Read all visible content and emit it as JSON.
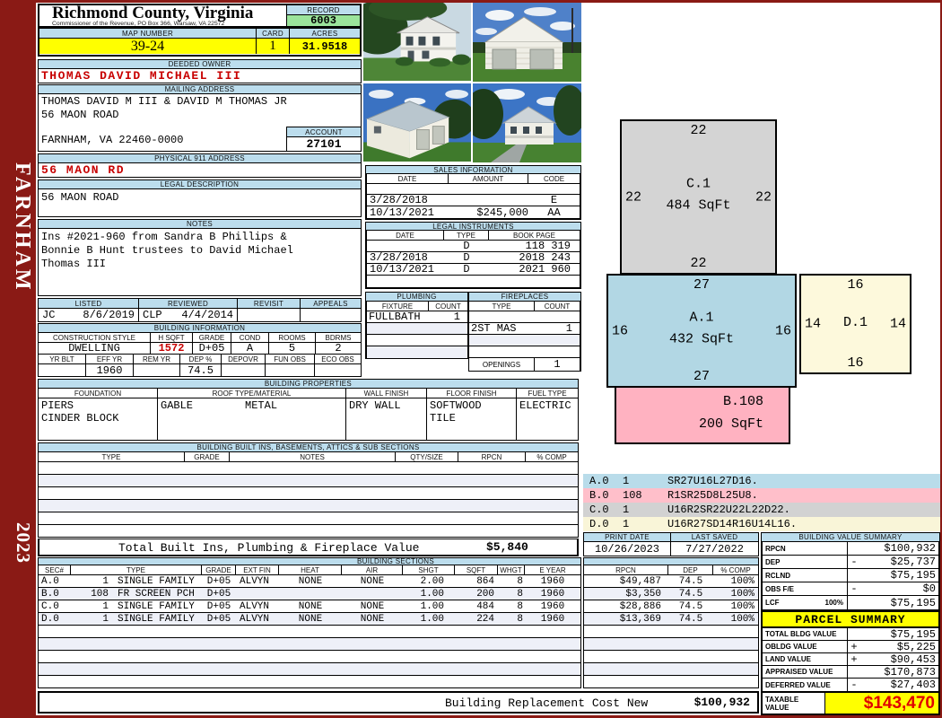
{
  "header": {
    "county": "Richmond County, Virginia",
    "commissioner": "Commissioner of the Revenue, PO Box 366, Warsaw, VA 22572",
    "record_label": "RECORD",
    "record_value": "6003",
    "map_label": "MAP NUMBER",
    "map_value": "39-24",
    "card_label": "CARD",
    "card_value": "1",
    "acres_label": "ACRES",
    "acres_value": "31.9518"
  },
  "sidebar": {
    "district": "FARNHAM",
    "year": "2023"
  },
  "owner": {
    "label": "DEEDED OWNER",
    "name": "THOMAS DAVID MICHAEL III"
  },
  "mailing": {
    "label": "MAILING ADDRESS",
    "line1": "THOMAS DAVID M III & DAVID M THOMAS JR",
    "line2": "56 MAON ROAD",
    "line3": "FARNHAM, VA 22460-0000",
    "account_label": "ACCOUNT",
    "account_value": "27101"
  },
  "physical": {
    "label": "PHYSICAL 911 ADDRESS",
    "value": "56 MAON RD"
  },
  "legal_description": {
    "label": "LEGAL DESCRIPTION",
    "value": "56 MAON ROAD"
  },
  "notes": {
    "label": "NOTES",
    "line1": "Ins #2021-960 from Sandra B Phillips &",
    "line2": "Bonnie B Hunt trustees to David Michael",
    "line3": "Thomas III"
  },
  "review": {
    "listed_label": "LISTED",
    "listed_by": "JC",
    "listed_date": "8/6/2019",
    "reviewed_label": "REVIEWED",
    "reviewed_by": "CLP",
    "reviewed_date": "4/4/2014",
    "revisit_label": "REVISIT",
    "revisit_value": "",
    "appeals_label": "APPEALS",
    "appeals_value": ""
  },
  "building_info": {
    "title": "BUILDING INFORMATION",
    "style_label": "CONSTRUCTION STYLE",
    "style": "DWELLING",
    "hsqft_label": "H SQFT",
    "hsqft": "1572",
    "grade_label": "GRADE",
    "grade": "D+05",
    "cond_label": "COND",
    "cond": "A",
    "rooms_label": "ROOMS",
    "rooms": "5",
    "bdrms_label": "BDRMS",
    "bdrms": "2",
    "yrblt_label": "YR BLT",
    "yrblt": "",
    "effyr_label": "EFF YR",
    "effyr": "1960",
    "remyr_label": "REM YR",
    "remyr": "",
    "dep_label": "DEP %",
    "dep": "74.5",
    "depovr_label": "DEPOVR",
    "depovr": "",
    "funobs_label": "FUN OBS",
    "funobs": "",
    "ecoobs_label": "ECO OBS",
    "ecoobs": ""
  },
  "properties": {
    "title": "BUILDING PROPERTIES",
    "foundation_label": "FOUNDATION",
    "foundation1": "PIERS",
    "foundation2": "CINDER BLOCK",
    "roof_label": "ROOF TYPE/MATERIAL",
    "roof_type": "GABLE",
    "roof_material": "METAL",
    "wall_label": "WALL FINISH",
    "wall": "DRY WALL",
    "floor_label": "FLOOR FINISH",
    "floor1": "SOFTWOOD",
    "floor2": "TILE",
    "fuel_label": "FUEL TYPE",
    "fuel": "ELECTRIC"
  },
  "built_ins": {
    "title": "BUILDING BUILT INS, BASEMENTS, ATTICS & SUB SECTIONS",
    "headers": [
      "TYPE",
      "GRADE",
      "NOTES",
      "QTY/SIZE",
      "RPCN",
      "% COMP"
    ]
  },
  "totals": {
    "built_label": "Total Built Ins, Plumbing & Fireplace Value",
    "built_value": "$5,840",
    "cost_label": "Building Replacement Cost New",
    "cost_value": "$100,932"
  },
  "sales": {
    "title": "SALES INFORMATION",
    "date_label": "DATE",
    "amount_label": "AMOUNT",
    "code_label": "CODE",
    "rows": [
      {
        "date": "",
        "amount": "",
        "code": ""
      },
      {
        "date": "3/28/2018",
        "amount": "",
        "code": "E"
      },
      {
        "date": "10/13/2021",
        "amount": "$245,000",
        "code": "AA"
      }
    ]
  },
  "instruments": {
    "title": "LEGAL INSTRUMENTS",
    "date_label": "DATE",
    "type_label": "TYPE",
    "book_label": "BOOK PAGE",
    "rows": [
      {
        "date": "",
        "type": "D",
        "book": "118 319"
      },
      {
        "date": "3/28/2018",
        "type": "D",
        "book": "2018 243"
      },
      {
        "date": "10/13/2021",
        "type": "D",
        "book": "2021 960"
      }
    ]
  },
  "plumbing": {
    "title": "PLUMBING",
    "fixture_label": "FIXTURE",
    "count_label": "COUNT",
    "rows": [
      {
        "fixture": "FULLBATH",
        "count": "1"
      },
      {
        "fixture": "",
        "count": ""
      },
      {
        "fixture": "",
        "count": ""
      },
      {
        "fixture": "",
        "count": ""
      }
    ]
  },
  "fireplaces": {
    "title": "FIREPLACES",
    "type_label": "TYPE",
    "count_label": "COUNT",
    "rows": [
      {
        "type": "",
        "count": ""
      },
      {
        "type": "2ST MAS",
        "count": "1"
      },
      {
        "type": "",
        "count": ""
      },
      {
        "type": "",
        "count": ""
      }
    ],
    "openings_label": "OPENINGS",
    "openings_value": "1"
  },
  "sketch": {
    "sections": [
      {
        "name": "C.1",
        "sqft": "484 SqFt",
        "top": "22",
        "left": "22",
        "right": "22",
        "bottom": "22"
      },
      {
        "name": "A.1",
        "sqft": "432 SqFt",
        "top": "27",
        "left": "16",
        "right": "16",
        "bottom": "27"
      },
      {
        "name": "D.1",
        "top": "16",
        "left": "14",
        "right": "14",
        "bottom": "16"
      },
      {
        "name": "B.108",
        "sqft": "200 SqFt"
      }
    ],
    "codes": [
      {
        "id": "A.0",
        "count": "1",
        "code": "SR27U16L27D16."
      },
      {
        "id": "B.0",
        "count": "108",
        "code": "R1SR25D8L25U8."
      },
      {
        "id": "C.0",
        "count": "1",
        "code": "U16R2SR22U22L22D22."
      },
      {
        "id": "D.0",
        "count": "1",
        "code": "U16R27SD14R16U14L16."
      }
    ]
  },
  "print_info": {
    "print_label": "PRINT DATE",
    "print_date": "10/26/2023",
    "saved_label": "LAST SAVED",
    "saved_date": "7/27/2022"
  },
  "value_summary": {
    "title": "BUILDING VALUE SUMMARY",
    "rows": [
      {
        "label": "RPCN",
        "pct": "",
        "op": "",
        "value": "$100,932"
      },
      {
        "label": "DEP",
        "pct": "",
        "op": "-",
        "value": "$25,737"
      },
      {
        "label": "RCLND",
        "pct": "",
        "op": "",
        "value": "$75,195"
      },
      {
        "label": "OBS F/E",
        "pct": "",
        "op": "-",
        "value": "$0"
      },
      {
        "label": "LCF",
        "pct": "100%",
        "op": "",
        "value": "$75,195"
      }
    ]
  },
  "sections": {
    "title": "BUILDING SECTIONS",
    "sec_label": "SEC#",
    "type_label": "TYPE",
    "grade_label": "GRADE",
    "ext_label": "EXT FIN",
    "heat_label": "HEAT",
    "air_label": "AIR",
    "shgt_label": "SHGT",
    "sqft_label": "SQFT",
    "whgt_label": "WHGT",
    "eyear_label": "E YEAR",
    "rpcn_label": "RPCN",
    "dep_label": "DEP",
    "comp_label": "% COMP",
    "rows": [
      {
        "sec": "A.0",
        "code": "1",
        "type": "SINGLE FAMILY",
        "grade": "D+05",
        "ext": "ALVYN",
        "heat": "NONE",
        "air": "NONE",
        "shgt": "2.00",
        "sqft": "864",
        "whgt": "8",
        "eyear": "1960",
        "rpcn": "$49,487",
        "dep": "74.5",
        "comp": "100%"
      },
      {
        "sec": "B.0",
        "code": "108",
        "type": "FR SCREEN PCH",
        "grade": "D+05",
        "ext": "",
        "heat": "",
        "air": "",
        "shgt": "1.00",
        "sqft": "200",
        "whgt": "8",
        "eyear": "1960",
        "rpcn": "$3,350",
        "dep": "74.5",
        "comp": "100%"
      },
      {
        "sec": "C.0",
        "code": "1",
        "type": "SINGLE FAMILY",
        "grade": "D+05",
        "ext": "ALVYN",
        "heat": "NONE",
        "air": "NONE",
        "shgt": "1.00",
        "sqft": "484",
        "whgt": "8",
        "eyear": "1960",
        "rpcn": "$28,886",
        "dep": "74.5",
        "comp": "100%"
      },
      {
        "sec": "D.0",
        "code": "1",
        "type": "SINGLE FAMILY",
        "grade": "D+05",
        "ext": "ALVYN",
        "heat": "NONE",
        "air": "NONE",
        "shgt": "1.00",
        "sqft": "224",
        "whgt": "8",
        "eyear": "1960",
        "rpcn": "$13,369",
        "dep": "74.5",
        "comp": "100%"
      }
    ]
  },
  "parcel": {
    "title": "PARCEL SUMMARY",
    "rows": [
      {
        "label": "TOTAL BLDG VALUE",
        "op": "",
        "value": "$75,195"
      },
      {
        "label": "OBLDG VALUE",
        "op": "+",
        "value": "$5,225"
      },
      {
        "label": "LAND VALUE",
        "op": "+",
        "value": "$90,453"
      },
      {
        "label": "APPRAISED VALUE",
        "op": "",
        "value": "$170,873"
      },
      {
        "label": "DEFERRED VALUE",
        "op": "-",
        "value": "$27,403"
      }
    ],
    "taxable_label1": "TAXABLE",
    "taxable_label2": "VALUE",
    "taxable_value": "$143,470"
  }
}
